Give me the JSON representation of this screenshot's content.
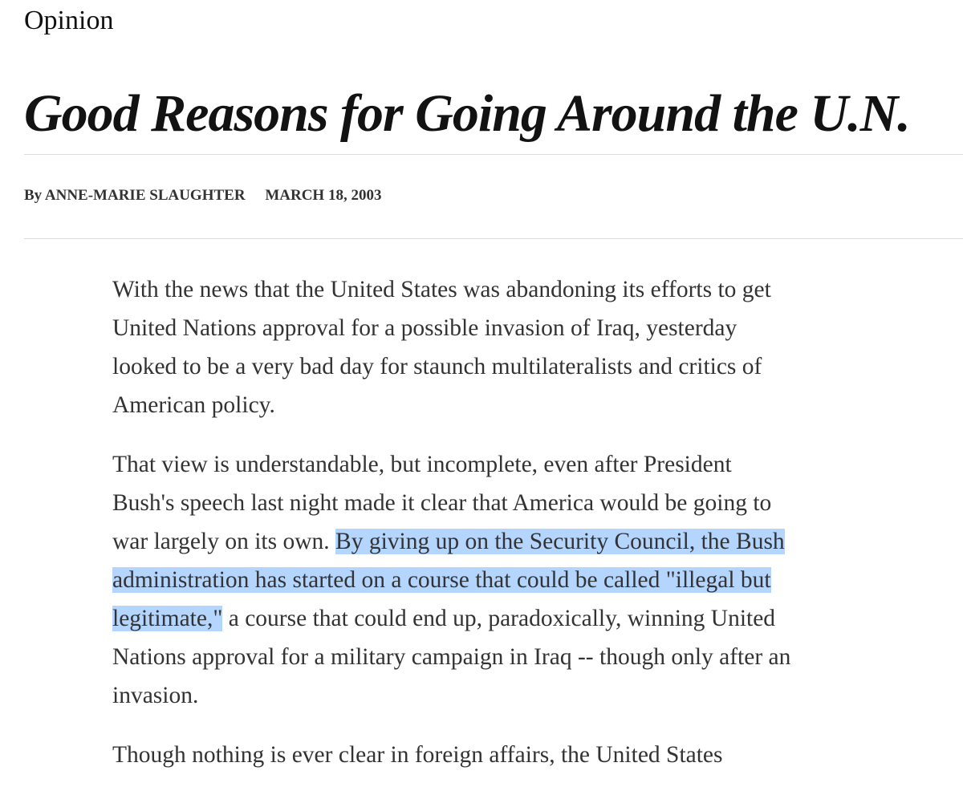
{
  "section": "Opinion",
  "headline": "Good Reasons for Going Around the U.N.",
  "byline": {
    "prefix": "By",
    "author": "ANNE-MARIE SLAUGHTER",
    "date": "MARCH 18, 2003"
  },
  "paragraphs": [
    {
      "lines": [
        "With the news that the United States was abandoning its efforts to get",
        "United Nations approval for a possible invasion of Iraq, yesterday",
        "looked to be a very bad day for staunch multilateralists and critics of",
        "American policy."
      ]
    },
    {
      "line1": "That view is understandable, but incomplete, even after President",
      "line2": "Bush's speech last night made it clear that America would be going to",
      "line3_plain": "war largely on its own. ",
      "line3_highlight": "By giving up on the Security Council, the Bush",
      "line4_highlight": "administration has started on a course that could be called \"illegal but",
      "line5_highlight": "legitimate,\"",
      "line5_plain": " a course that could end up, paradoxically, winning United",
      "line6": "Nations approval for a military campaign in Iraq -- though only after an",
      "line7": "invasion."
    },
    {
      "partial_line": "Though nothing is ever clear in foreign affairs, the United States"
    }
  ],
  "colors": {
    "highlight": "#b4d5fe",
    "rule": "#dcdcdc",
    "text": "#333333"
  }
}
